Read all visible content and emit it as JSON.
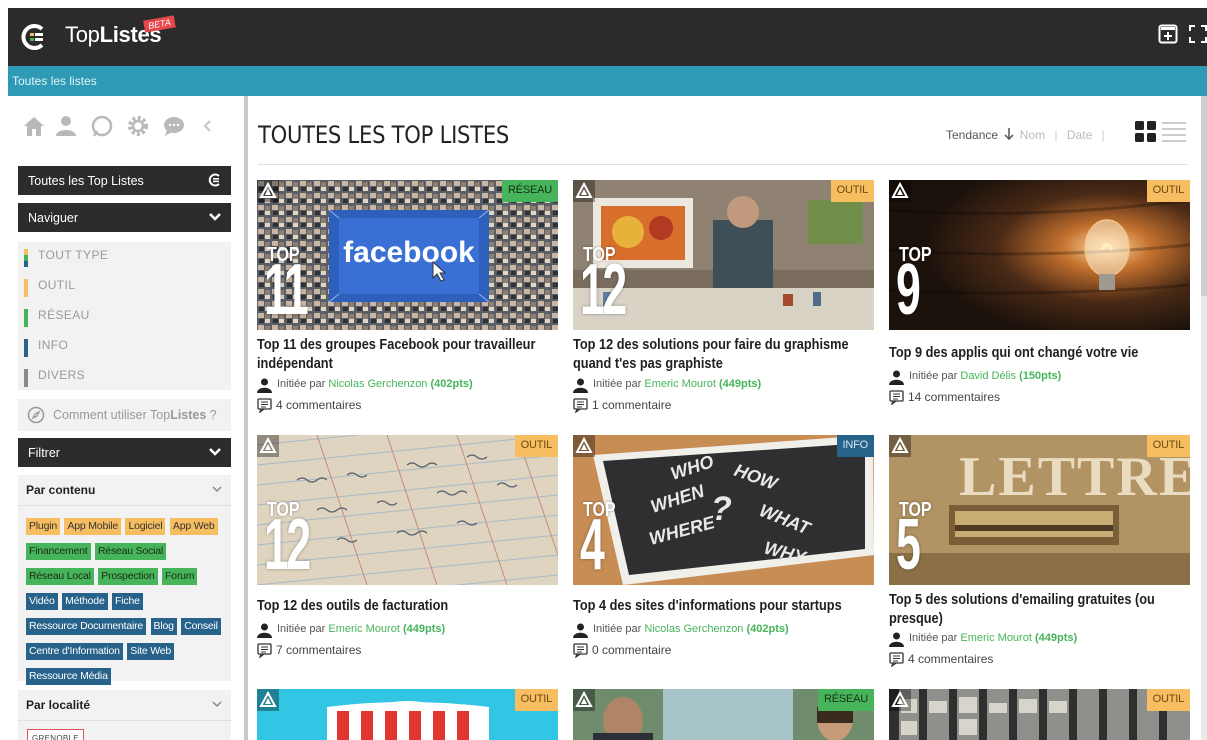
{
  "header": {
    "brand_prefix": "Top",
    "brand_bold": "Listes",
    "beta": "BETA",
    "icons": [
      "logo-icon",
      "add-list-icon",
      "fullscreen-icon"
    ]
  },
  "breadcrumb": {
    "label": "Toutes les listes"
  },
  "sidebar": {
    "icons": [
      "home-icon",
      "user-icon",
      "chat-bubble-icon",
      "gear-icon",
      "comment-icon",
      "chevron-left-icon"
    ],
    "all_lists": "Toutes les Top Listes",
    "navigate": "Naviguer",
    "types": [
      {
        "label": "TOUT TYPE",
        "color": "multi"
      },
      {
        "label": "OUTIL",
        "color": "#f7be61"
      },
      {
        "label": "RÉSEAU",
        "color": "#46b45a"
      },
      {
        "label": "INFO",
        "color": "#26628a"
      },
      {
        "label": "DIVERS",
        "color": "#8a8a8a"
      }
    ],
    "howto_prefix": "Comment utiliser Top",
    "howto_bold": "Listes",
    "howto_suffix": " ?",
    "filter": "Filtrer",
    "by_content": "Par contenu",
    "tags": [
      {
        "label": "Plugin",
        "kind": "outil"
      },
      {
        "label": "App Mobile",
        "kind": "outil"
      },
      {
        "label": "Logiciel",
        "kind": "outil"
      },
      {
        "label": "App Web",
        "kind": "outil"
      },
      {
        "label": "Financement",
        "kind": "reseau"
      },
      {
        "label": "Réseau Social",
        "kind": "reseau"
      },
      {
        "label": "Réseau Local",
        "kind": "reseau"
      },
      {
        "label": "Prospection",
        "kind": "reseau"
      },
      {
        "label": "Forum",
        "kind": "reseau"
      },
      {
        "label": "Vidéo",
        "kind": "info"
      },
      {
        "label": "Méthode",
        "kind": "info"
      },
      {
        "label": "Fiche",
        "kind": "info"
      },
      {
        "label": "Ressource Documentaire",
        "kind": "info"
      },
      {
        "label": "Blog",
        "kind": "info"
      },
      {
        "label": "Conseil",
        "kind": "info"
      },
      {
        "label": "Centre d'Information",
        "kind": "info"
      },
      {
        "label": "Site Web",
        "kind": "info"
      },
      {
        "label": "Ressource Média",
        "kind": "info"
      }
    ],
    "by_location": "Par localité",
    "location_tag": "GRENOBLE"
  },
  "main": {
    "title": "TOUTES LES TOP LISTES",
    "sort_trend": "Tendance",
    "sort_name": "Nom",
    "sort_date": "Date",
    "pipe": "|",
    "initiated_by": "Initiée par ",
    "cards": [
      {
        "badge": "RÉSEAU",
        "badge_kind": "reseau",
        "top": "TOP",
        "number": "11",
        "title": "Top 11 des groupes Facebook pour travailleur indépendant",
        "author": "Nicolas Gerchenzon",
        "points": "(402pts)",
        "comments": "4 commentaires"
      },
      {
        "badge": "OUTIL",
        "badge_kind": "outil",
        "top": "TOP",
        "number": "12",
        "title": "Top 12 des solutions pour faire du graphisme quand t'es pas graphiste",
        "author": "Emeric Mourot",
        "points": "(449pts)",
        "comments": "1 commentaire"
      },
      {
        "badge": "OUTIL",
        "badge_kind": "outil",
        "top": "TOP",
        "number": "9",
        "title": "Top 9 des applis qui ont changé votre vie",
        "author": "David Délis",
        "points": "(150pts)",
        "comments": "14 commentaires"
      },
      {
        "badge": "OUTIL",
        "badge_kind": "outil",
        "top": "TOP",
        "number": "12",
        "title": "Top 12 des outils de facturation",
        "author": "Emeric Mourot",
        "points": "(449pts)",
        "comments": "7 commentaires"
      },
      {
        "badge": "INFO",
        "badge_kind": "info",
        "top": "TOP",
        "number": "4",
        "title": "Top 4 des sites d'informations pour startups",
        "author": "Nicolas Gerchenzon",
        "points": "(402pts)",
        "comments": "0 commentaire"
      },
      {
        "badge": "OUTIL",
        "badge_kind": "outil",
        "top": "TOP",
        "number": "5",
        "title": "Top 5 des solutions d'emailing gratuites (ou presque)",
        "author": "Emeric Mourot",
        "points": "(449pts)",
        "comments": "4 commentaires"
      },
      {
        "badge": "OUTIL",
        "badge_kind": "outil"
      },
      {
        "badge": "RÉSEAU",
        "badge_kind": "reseau"
      },
      {
        "badge": "OUTIL",
        "badge_kind": "outil"
      }
    ],
    "image_text": {
      "facebook": "facebook",
      "lettres": "LETTRES",
      "chalk": [
        "WHO",
        "HOW",
        "WHEN",
        "WHAT",
        "WHERE",
        "WHY",
        "?"
      ]
    }
  },
  "colors": {
    "topbar": "#2b2b2b",
    "breadcrumb_bar": "#2e9ab6",
    "outil": "#f7be61",
    "reseau": "#46b45a",
    "info": "#26628a",
    "divers": "#8a8a8a"
  }
}
